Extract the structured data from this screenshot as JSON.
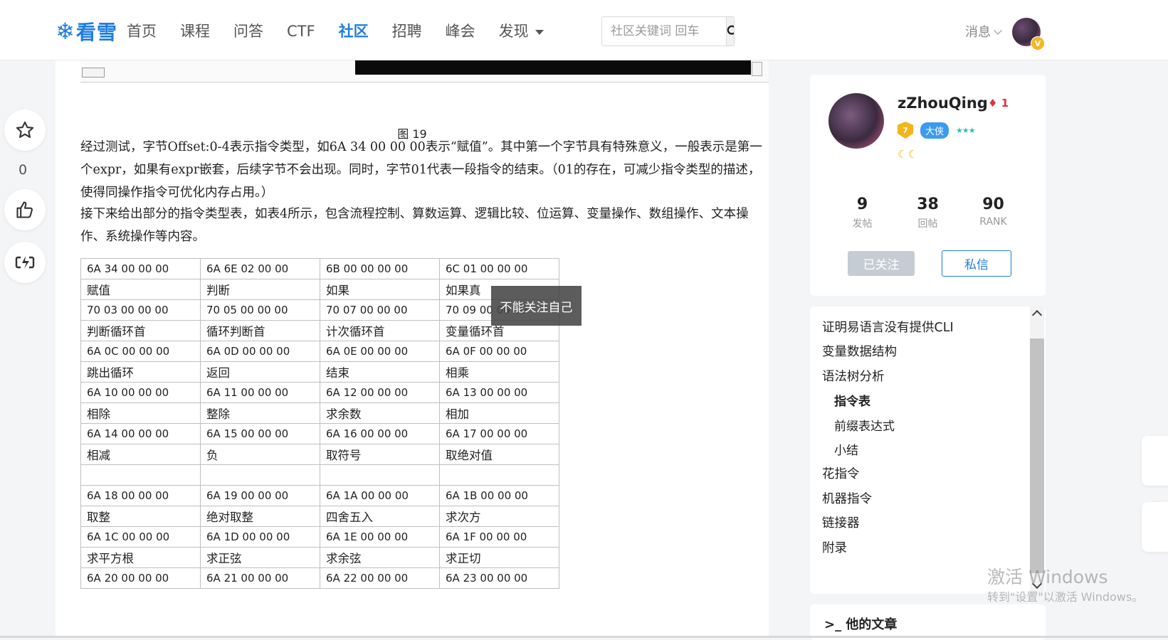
{
  "header": {
    "logo_text": "看雪",
    "nav": [
      "首页",
      "课程",
      "问答",
      "CTF",
      "社区",
      "招聘",
      "峰会",
      "发现"
    ],
    "active_nav": "社区",
    "search_placeholder": "社区关键词 回车",
    "messages_label": "消息",
    "avatar_badge": "V"
  },
  "left_actions": {
    "favorite_count": "0"
  },
  "article": {
    "figure_caption": "图 19",
    "paragraph1": "经过测试，字节Offset:0-4表示指令类型，如6A 34 00 00 00表示“赋值”。其中第一个字节具有特殊意义，一般表示是第一个expr，如果有expr嵌套，后续字节不会出现。同时，字节01代表一段指令的结束。（01的存在，可减少指令类型的描述，使得同操作指令可优化内存占用。）",
    "paragraph2": "接下来给出部分的指令类型表，如表4所示，包含流程控制、算数运算、逻辑比较、位运算、变量操作、数组操作、文本操作、系统操作等内容。",
    "table_rows": [
      [
        "6A 34 00 00 00",
        "6A 6E 02 00 00",
        "6B 00 00 00 00",
        "6C 01 00 00 00"
      ],
      [
        "赋值",
        "判断",
        "如果",
        "如果真"
      ],
      [
        "70 03 00 00 00",
        "70 05 00 00 00",
        "70 07 00 00 00",
        "70 09 00 00 00"
      ],
      [
        "判断循环首",
        "循环判断首",
        "计次循环首",
        "变量循环首"
      ],
      [
        " 6A 0C 00 00 00",
        "6A 0D 00 00 00",
        "6A 0E 00 00 00",
        "6A 0F 00 00 00"
      ],
      [
        "跳出循环",
        "返回",
        "结束",
        "相乘"
      ],
      [
        "6A 10 00 00 00",
        "6A 11 00 00 00",
        "6A 12 00 00 00",
        "6A 13 00 00 00"
      ],
      [
        "相除",
        "整除",
        "求余数",
        "相加"
      ],
      [
        "6A 14 00 00 00",
        "6A 15 00 00 00",
        "6A 16 00 00 00",
        "6A 17 00 00 00"
      ],
      [
        "相减",
        "负",
        "取符号",
        "取绝对值"
      ],
      [
        "",
        "",
        "",
        ""
      ],
      [
        "6A 18 00 00 00",
        "6A 19 00 00 00",
        "6A 1A 00 00 00",
        "6A 1B 00 00 00"
      ],
      [
        "取整",
        "绝对取整",
        "四舍五入",
        "求次方"
      ],
      [
        "6A 1C 00 00 00",
        "6A 1D 00 00 00",
        "6A 1E 00 00 00",
        "6A 1F 00 00 00"
      ],
      [
        "求平方根",
        "求正弦",
        "求余弦",
        "求正切"
      ],
      [
        "6A 20 00 00 00",
        "6A 21 00 00 00",
        "6A 22 00 00 00",
        "6A 23 00 00 00"
      ]
    ],
    "tooltip": "不能关注自己"
  },
  "author": {
    "name": "zZhouQing",
    "rank_number": "1",
    "level": "7",
    "title_badge": "大侠",
    "stats": [
      {
        "value": "9",
        "label": "发帖"
      },
      {
        "value": "38",
        "label": "回帖"
      },
      {
        "value": "90",
        "label": "RANK"
      }
    ],
    "followed_label": "已关注",
    "pm_label": "私信"
  },
  "toc": {
    "items": [
      {
        "label": "证明易语言没有提供CLI",
        "level": 1,
        "active": false
      },
      {
        "label": "变量数据结构",
        "level": 1,
        "active": false
      },
      {
        "label": "语法树分析",
        "level": 1,
        "active": false
      },
      {
        "label": "指令表",
        "level": 2,
        "active": true
      },
      {
        "label": "前缀表达式",
        "level": 2,
        "active": false
      },
      {
        "label": "小结",
        "level": 2,
        "active": false
      },
      {
        "label": "花指令",
        "level": 1,
        "active": false
      },
      {
        "label": "机器指令",
        "level": 1,
        "active": false
      },
      {
        "label": "链接器",
        "level": 1,
        "active": false
      },
      {
        "label": "附录",
        "level": 1,
        "active": false
      }
    ]
  },
  "other_articles": {
    "title": "他的文章"
  },
  "watermark": {
    "title": "激活 Windows",
    "subtitle": "转到\"设置\"以激活 Windows。"
  },
  "colors": {
    "brand": "#1f7de0",
    "tooltip_bg": "#464646"
  }
}
